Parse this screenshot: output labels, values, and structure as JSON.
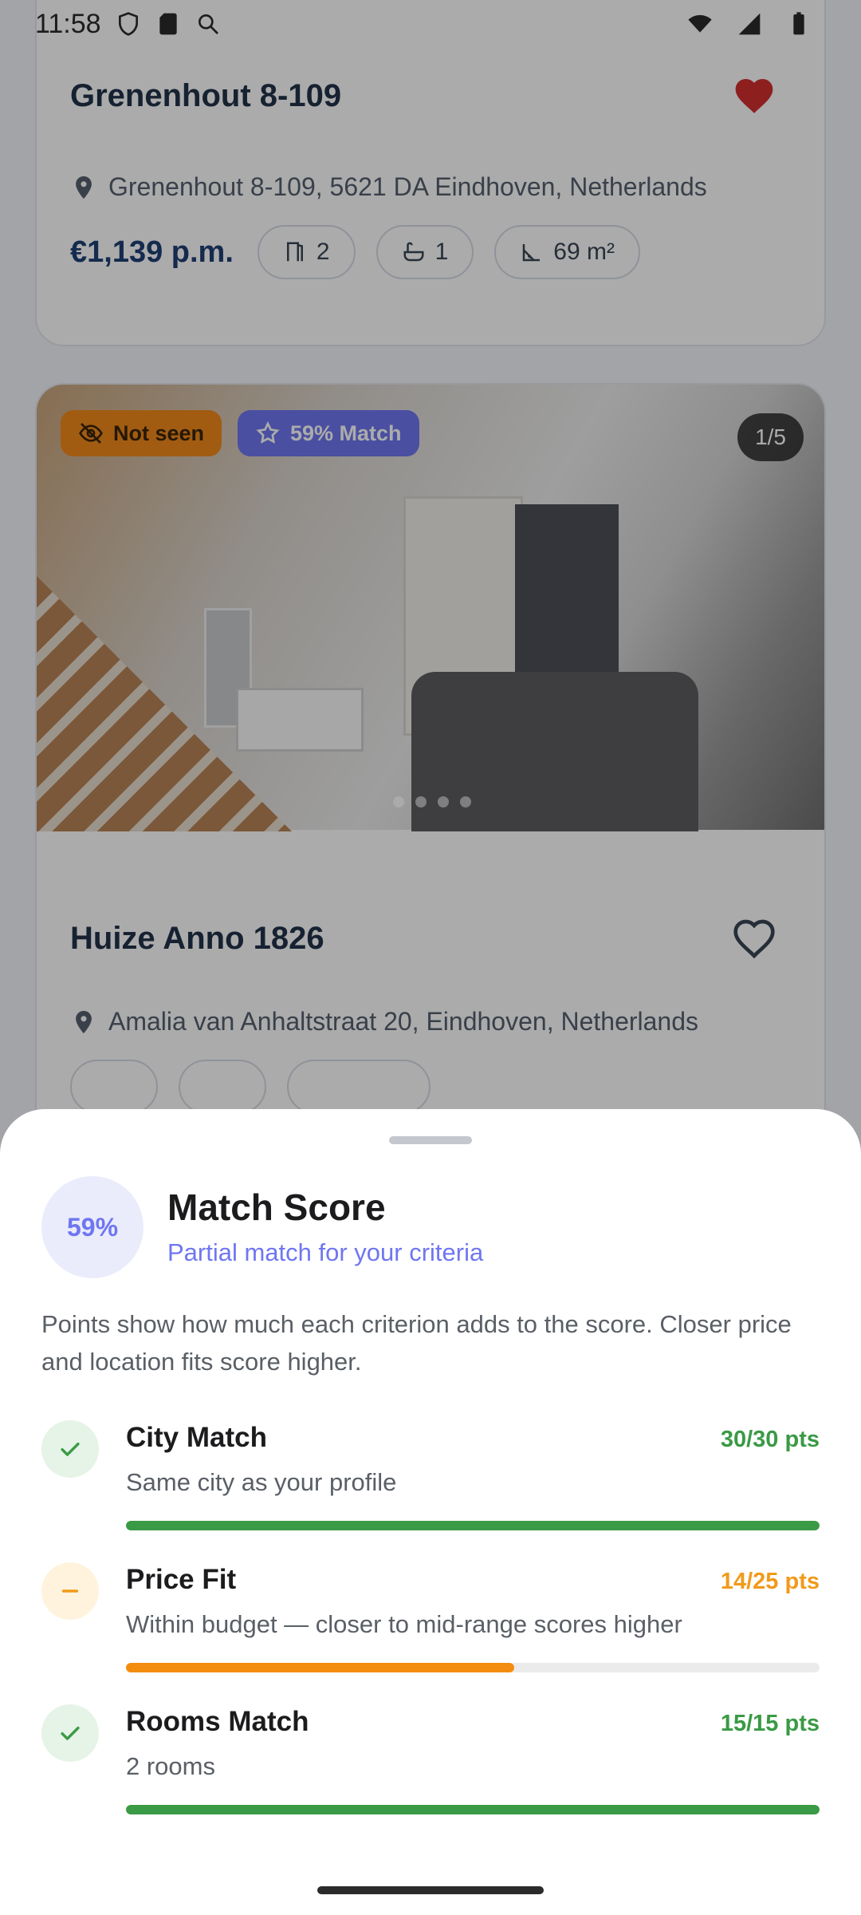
{
  "status_bar": {
    "time": "11:58"
  },
  "listing_1": {
    "title": "Grenenhout 8-109",
    "favorited": true,
    "address": "Grenenhout 8-109, 5621 DA Eindhoven, Netherlands",
    "price": "€1,139 p.m.",
    "rooms": "2",
    "bathrooms": "1",
    "area": "69 m²"
  },
  "listing_2": {
    "badge_seen": "Not seen",
    "badge_match": "59% Match",
    "photo_counter": "1/5",
    "photo_dots": 4,
    "title": "Huize Anno 1826",
    "favorited": false,
    "address": "Amalia van Anhaltstraat 20, Eindhoven, Netherlands"
  },
  "match_sheet": {
    "score": "59%",
    "title": "Match Score",
    "subtitle": "Partial match for your criteria",
    "description": "Points show how much each criterion adds to the score. Closer price and location fits score higher.",
    "criteria": [
      {
        "name": "City Match",
        "points": "30/30 pts",
        "description": "Same city as your profile",
        "status": "ok",
        "fill": 1.0,
        "icon": "check-icon"
      },
      {
        "name": "Price Fit",
        "points": "14/25 pts",
        "description": "Within budget — closer to mid-range scores higher",
        "status": "partial",
        "fill": 0.56,
        "icon": "minus-icon"
      },
      {
        "name": "Rooms Match",
        "points": "15/15 pts",
        "description": "2 rooms",
        "status": "ok",
        "fill": 1.0,
        "icon": "check-icon"
      }
    ]
  },
  "colors": {
    "accent": "#6f76f0",
    "ok": "#3a9a45",
    "partial": "#f19a1a",
    "favorite": "#d32f2f",
    "price": "#1f3f75"
  }
}
